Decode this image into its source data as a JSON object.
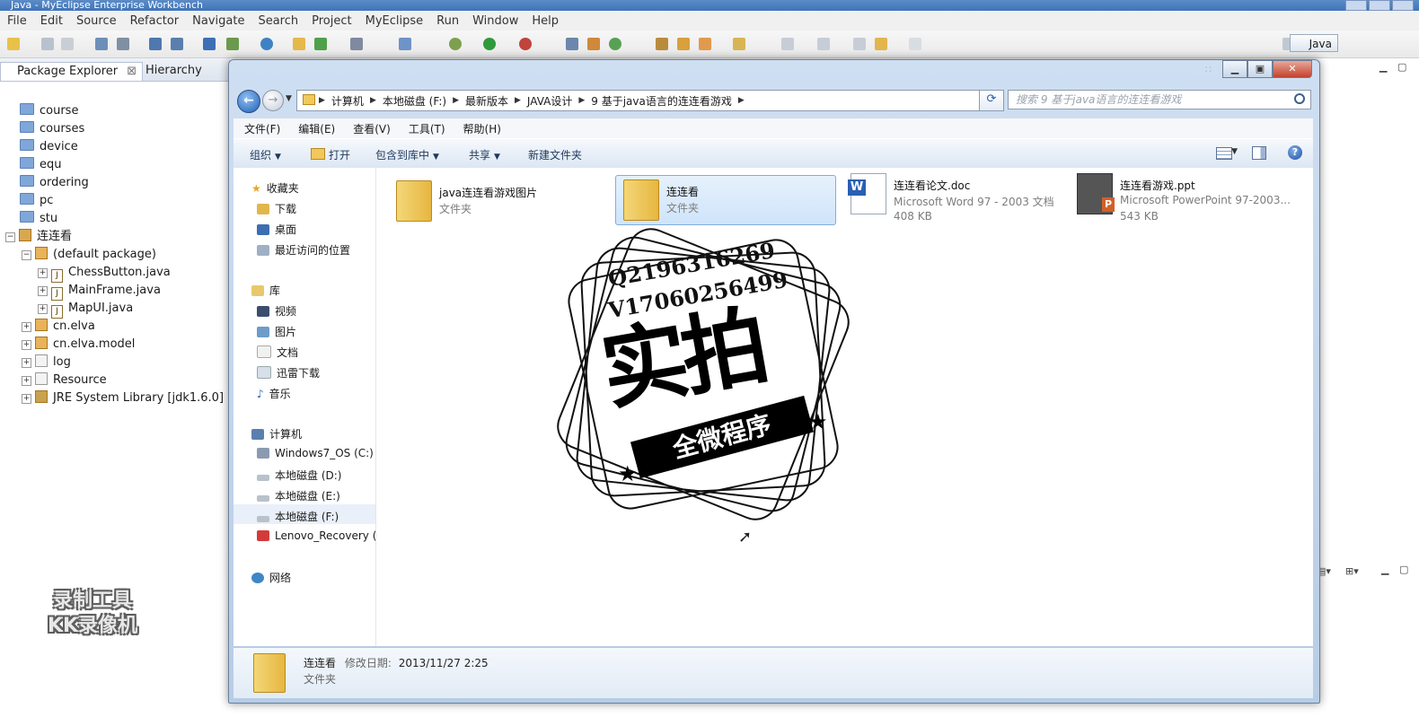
{
  "eclipse": {
    "title": "Java - MyEclipse Enterprise Workbench",
    "menu": [
      "File",
      "Edit",
      "Source",
      "Refactor",
      "Navigate",
      "Search",
      "Project",
      "MyEclipse",
      "Run",
      "Window",
      "Help"
    ],
    "perspective": "Java",
    "tabs": {
      "package_explorer": "Package Explorer",
      "hierarchy": "Hierarchy"
    },
    "tree": [
      {
        "label": "course",
        "type": "folder"
      },
      {
        "label": "courses",
        "type": "folder"
      },
      {
        "label": "device",
        "type": "folder"
      },
      {
        "label": "equ",
        "type": "folder"
      },
      {
        "label": "ordering",
        "type": "folder"
      },
      {
        "label": "pc",
        "type": "folder"
      },
      {
        "label": "stu",
        "type": "folder"
      },
      {
        "label": "连连看",
        "type": "project"
      },
      {
        "label": "(default package)",
        "type": "package"
      },
      {
        "label": "ChessButton.java",
        "type": "java"
      },
      {
        "label": "MainFrame.java",
        "type": "java"
      },
      {
        "label": "MapUI.java",
        "type": "java"
      },
      {
        "label": "cn.elva",
        "type": "package"
      },
      {
        "label": "cn.elva.model",
        "type": "package"
      },
      {
        "label": "log",
        "type": "package"
      },
      {
        "label": "Resource",
        "type": "package"
      },
      {
        "label": "JRE System Library [jdk1.6.0]",
        "type": "library"
      }
    ],
    "recorder_watermark": {
      "line1": "录制工具",
      "line2": "KK录像机"
    }
  },
  "explorer": {
    "address": [
      "计算机",
      "本地磁盘 (F:)",
      "最新版本",
      "JAVA设计",
      "9 基于java语言的连连看游戏"
    ],
    "search_placeholder": "搜索 9 基于java语言的连连看游戏",
    "menu": [
      "文件(F)",
      "编辑(E)",
      "查看(V)",
      "工具(T)",
      "帮助(H)"
    ],
    "commands": {
      "organize": "组织",
      "open": "打开",
      "include_library": "包含到库中",
      "share": "共享",
      "new_folder": "新建文件夹"
    },
    "nav": {
      "favorites": "收藏夹",
      "favorites_items": [
        "下载",
        "桌面",
        "最近访问的位置"
      ],
      "libraries": "库",
      "libraries_items": [
        "视频",
        "图片",
        "文档",
        "迅雷下载",
        "音乐"
      ],
      "computer": "计算机",
      "computer_items": [
        "Windows7_OS (C:)",
        "本地磁盘 (D:)",
        "本地磁盘 (E:)",
        "本地磁盘 (F:)",
        "Lenovo_Recovery ("
      ],
      "network": "网络"
    },
    "files": [
      {
        "name": "java连连看游戏图片",
        "sub": "文件夹",
        "sub2": "",
        "icon": "folder-icon"
      },
      {
        "name": "连连看",
        "sub": "文件夹",
        "sub2": "",
        "icon": "folder-icon"
      },
      {
        "name": "连连看论文.doc",
        "sub": "Microsoft Word 97 - 2003 文档",
        "sub2": "408 KB",
        "icon": "word-doc-icon"
      },
      {
        "name": "连连看游戏.ppt",
        "sub": "Microsoft PowerPoint 97-2003...",
        "sub2": "543 KB",
        "icon": "ppt-icon"
      }
    ],
    "details": {
      "name": "连连看",
      "date_label": "修改日期:",
      "date": "2013/11/27 2:25",
      "type": "文件夹"
    }
  },
  "stamp": {
    "line1": "Q2196316269",
    "line2": "V17060256499",
    "big": "实拍",
    "banner": "全微程序"
  }
}
